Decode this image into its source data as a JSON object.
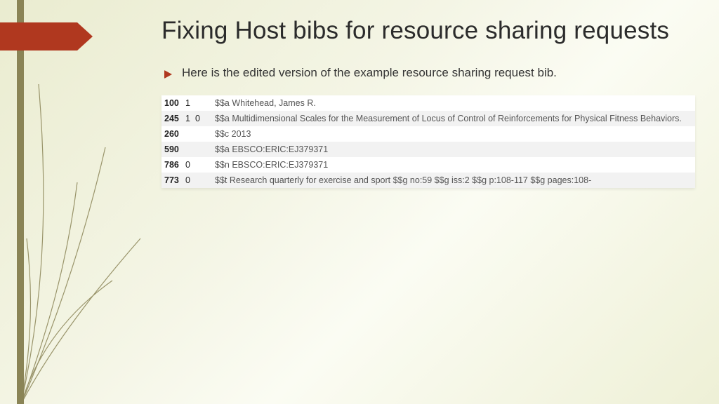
{
  "title": "Fixing Host bibs for resource sharing requests",
  "bullet": "Here is the edited version of the example resource sharing request bib.",
  "marc": {
    "rows": [
      {
        "tag": "100",
        "ind1": "1",
        "ind2": "",
        "subfields": "$$a Whitehead, James R."
      },
      {
        "tag": "245",
        "ind1": "1",
        "ind2": "0",
        "subfields": "$$a Multidimensional Scales for the Measurement of Locus of Control of Reinforcements for Physical Fitness Behaviors."
      },
      {
        "tag": "260",
        "ind1": "",
        "ind2": "",
        "subfields": "$$c 2013"
      },
      {
        "tag": "590",
        "ind1": "",
        "ind2": "",
        "subfields": "$$a EBSCO:ERIC:EJ379371"
      },
      {
        "tag": "786",
        "ind1": "0",
        "ind2": "",
        "subfields": "$$n EBSCO:ERIC:EJ379371"
      },
      {
        "tag": "773",
        "ind1": "0",
        "ind2": "",
        "subfields": "$$t Research quarterly for exercise and sport $$g no:59  $$g iss:2  $$g p:108-117  $$g pages:108-"
      }
    ]
  }
}
